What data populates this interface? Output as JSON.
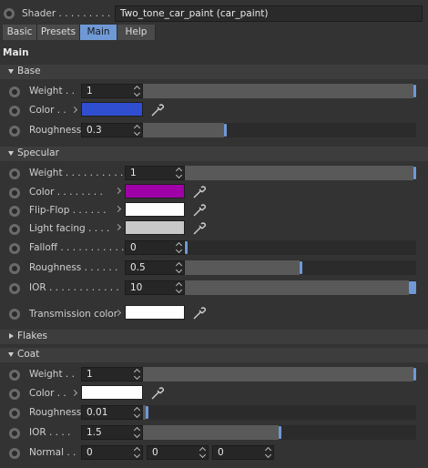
{
  "header": {
    "label": "Shader . . . . . . . . .",
    "shader_value": "Two_tone_car_paint (car_paint)"
  },
  "tabs": [
    {
      "label": "Basic"
    },
    {
      "label": "Presets"
    },
    {
      "label": "Main"
    },
    {
      "label": "Help"
    }
  ],
  "active_tab": "Main",
  "panel_title": "Main",
  "sections": {
    "base": "Base",
    "specular": "Specular",
    "flakes": "Flakes",
    "coat": "Coat"
  },
  "base": {
    "weight_label": "Weight . .",
    "weight_value": "1",
    "weight_fraction": 1.0,
    "color_label": "Color . .",
    "color": "#2f4fd0",
    "roughness_label": "Roughness",
    "roughness_value": "0.3",
    "roughness_fraction": 0.3
  },
  "specular": {
    "weight_label": "Weight . . . . . . . . . .",
    "weight_value": "1",
    "weight_fraction": 1.0,
    "color_label": "Color . . . . . . . .",
    "color": "#a000a8",
    "flipflop_label": "Flip-Flop . . . . . .",
    "flipflop_color": "#ffffff",
    "lightfacing_label": "Light facing . . . .",
    "lightfacing_color": "#c8c8c8",
    "falloff_label": "Falloff . . . . . . . . . . .",
    "falloff_value": "0",
    "falloff_fraction": 0.0,
    "roughness_label": "Roughness . . . . . .",
    "roughness_value": "0.5",
    "roughness_fraction": 0.5,
    "ior_label": "IOR . . . . . . . . . . . .",
    "ior_value": "10",
    "ior_fraction": 1.0,
    "transmission_label": "Transmission color",
    "transmission_color": "#ffffff"
  },
  "coat": {
    "weight_label": "Weight . .",
    "weight_value": "1",
    "weight_fraction": 1.0,
    "color_label": "Color . .",
    "color": "#ffffff",
    "roughness_label": "Roughness",
    "roughness_value": "0.01",
    "roughness_fraction": 0.01,
    "ior_label": "IOR . . . .",
    "ior_value": "1.5",
    "ior_fraction": 0.5,
    "normal_label": "Normal . .",
    "normal_x": "0",
    "normal_y": "0",
    "normal_z": "0"
  },
  "accent_color": "#6f99d6"
}
